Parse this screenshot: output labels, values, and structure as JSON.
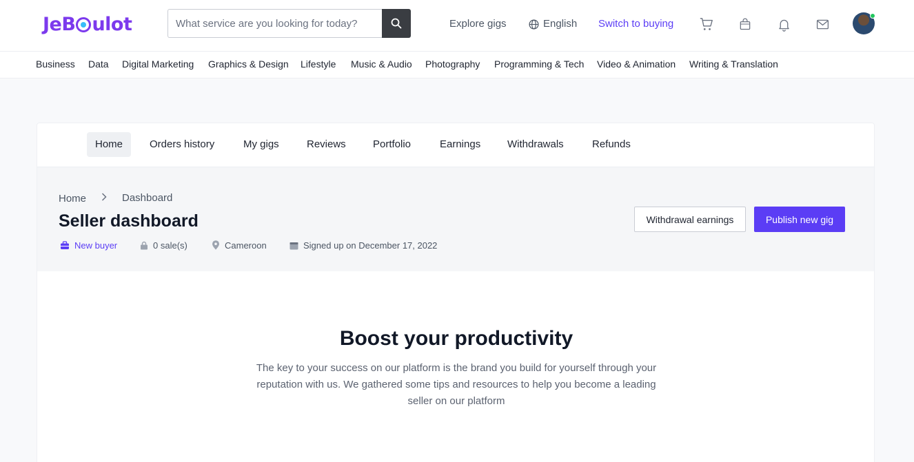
{
  "header": {
    "logo_text_left": "JeB",
    "logo_text_right": "ulot",
    "search": {
      "placeholder": "What service are you looking for today?"
    },
    "links": {
      "explore": "Explore gigs",
      "language": "English",
      "switch": "Switch to buying"
    }
  },
  "categories": [
    "Business",
    "Data",
    "Digital Marketing",
    "Graphics & Design",
    "Lifestyle",
    "Music & Audio",
    "Photography",
    "Programming & Tech",
    "Video & Animation",
    "Writing & Translation"
  ],
  "tabs": [
    "Home",
    "Orders history",
    "My gigs",
    "Reviews",
    "Portfolio",
    "Earnings",
    "Withdrawals",
    "Refunds"
  ],
  "dashboard": {
    "breadcrumb": {
      "home": "Home",
      "current": "Dashboard"
    },
    "title": "Seller dashboard",
    "meta": {
      "status": "New buyer",
      "sales": "0 sale(s)",
      "country": "Cameroon",
      "signup": "Signed up on December 17, 2022"
    },
    "buttons": {
      "withdraw": "Withdrawal earnings",
      "publish": "Publish new gig"
    }
  },
  "boost": {
    "heading": "Boost your productivity",
    "text": "The key to your success on our platform is the brand you build for yourself through your reputation with us. We gathered some tips and resources to help you become a leading seller on our platform"
  },
  "colors": {
    "accent": "#5b3df5",
    "logo": "#7c3aed",
    "online": "#22c55e"
  }
}
